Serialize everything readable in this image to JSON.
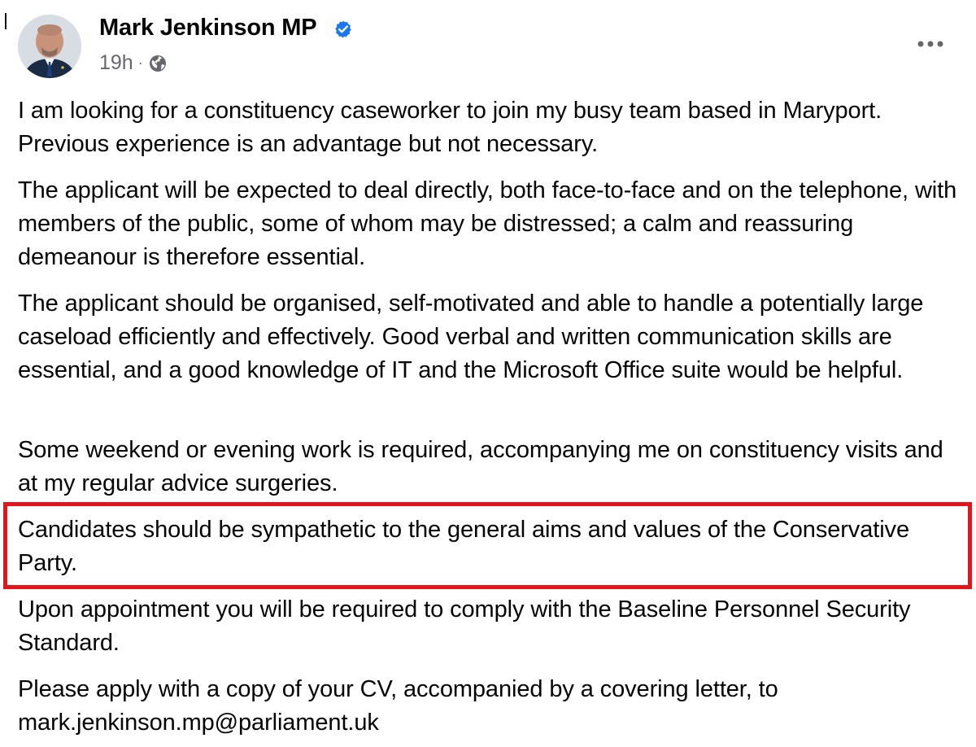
{
  "post": {
    "author": {
      "name": "Mark Jenkinson MP",
      "verified": true,
      "avatar": "profile-photo"
    },
    "meta": {
      "time": "19h",
      "separator": "·",
      "audience_icon": "globe-icon"
    },
    "menu_icon": "more-options-icon",
    "paragraphs": [
      "I am looking for a constituency caseworker to join my busy team based in Maryport. Previous experience is an advantage but not necessary.",
      "The applicant will be expected to deal directly, both face-to-face and on the telephone, with members of the public, some of whom may be distressed; a calm and reassuring demeanour is therefore essential.",
      "The applicant should be organised, self-motivated and able to handle a potentially large caseload efficiently and effectively. Good verbal and written communication skills are essential, and a good knowledge of IT and the Microsoft Office suite would be helpful.",
      "Some weekend or evening work is required, accompanying me on constituency visits and at my regular advice surgeries.",
      "Candidates should be sympathetic to the general aims and values of the Conservative Party.",
      "Upon appointment you will be required to comply with the Baseline Personnel Security Standard.",
      "Please apply with a copy of your CV, accompanied by a covering letter, to mark.jenkinson.mp@parliament.uk"
    ],
    "highlighted_paragraph_index": 4
  },
  "colors": {
    "text": "#050505",
    "meta_text": "#65676b",
    "verified_blue": "#1877f2",
    "highlight_red": "#e3141b",
    "background": "#ffffff"
  }
}
